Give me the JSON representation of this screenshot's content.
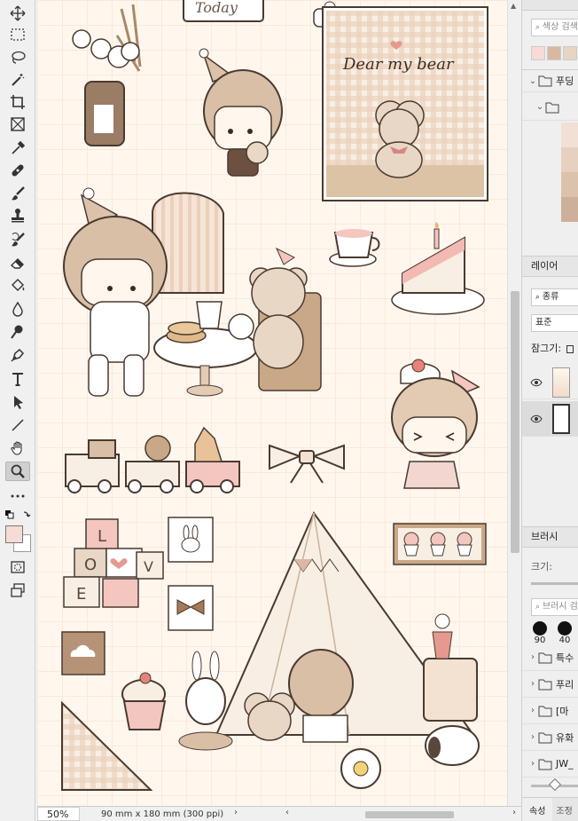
{
  "canvas": {
    "sticker_today": "Today",
    "poster_title": "Dear my bear",
    "blocks": [
      "L",
      "O",
      "V",
      "E"
    ]
  },
  "status": {
    "zoom": "50%",
    "doc_info": "90 mm x 180 mm (300 ppi)"
  },
  "panels": {
    "swatches": {
      "search_placeholder": "색상 검색",
      "colors": [
        "#f6dcd4",
        "#d9b8a0",
        "#e6d5c2",
        "#c9a58a"
      ]
    },
    "library": {
      "folder_1": "푸딩",
      "colors": [
        "#f2dfd6",
        "#e6d0bf",
        "#dcc2aa",
        "#cdb09a",
        "#f4e2d6"
      ]
    },
    "layers": {
      "title": "레이어",
      "filter_label": "종류",
      "blend_mode": "표준",
      "lock_label": "잠그기:"
    },
    "brushes": {
      "title": "브러시",
      "size_label": "크기:",
      "search_placeholder": "브러시 검색",
      "presets": [
        "90",
        "40"
      ],
      "folders": [
        "특수",
        "푸리",
        "[마",
        "유화",
        "JW_"
      ]
    },
    "bottom_tabs": [
      "속성",
      "조정"
    ]
  }
}
